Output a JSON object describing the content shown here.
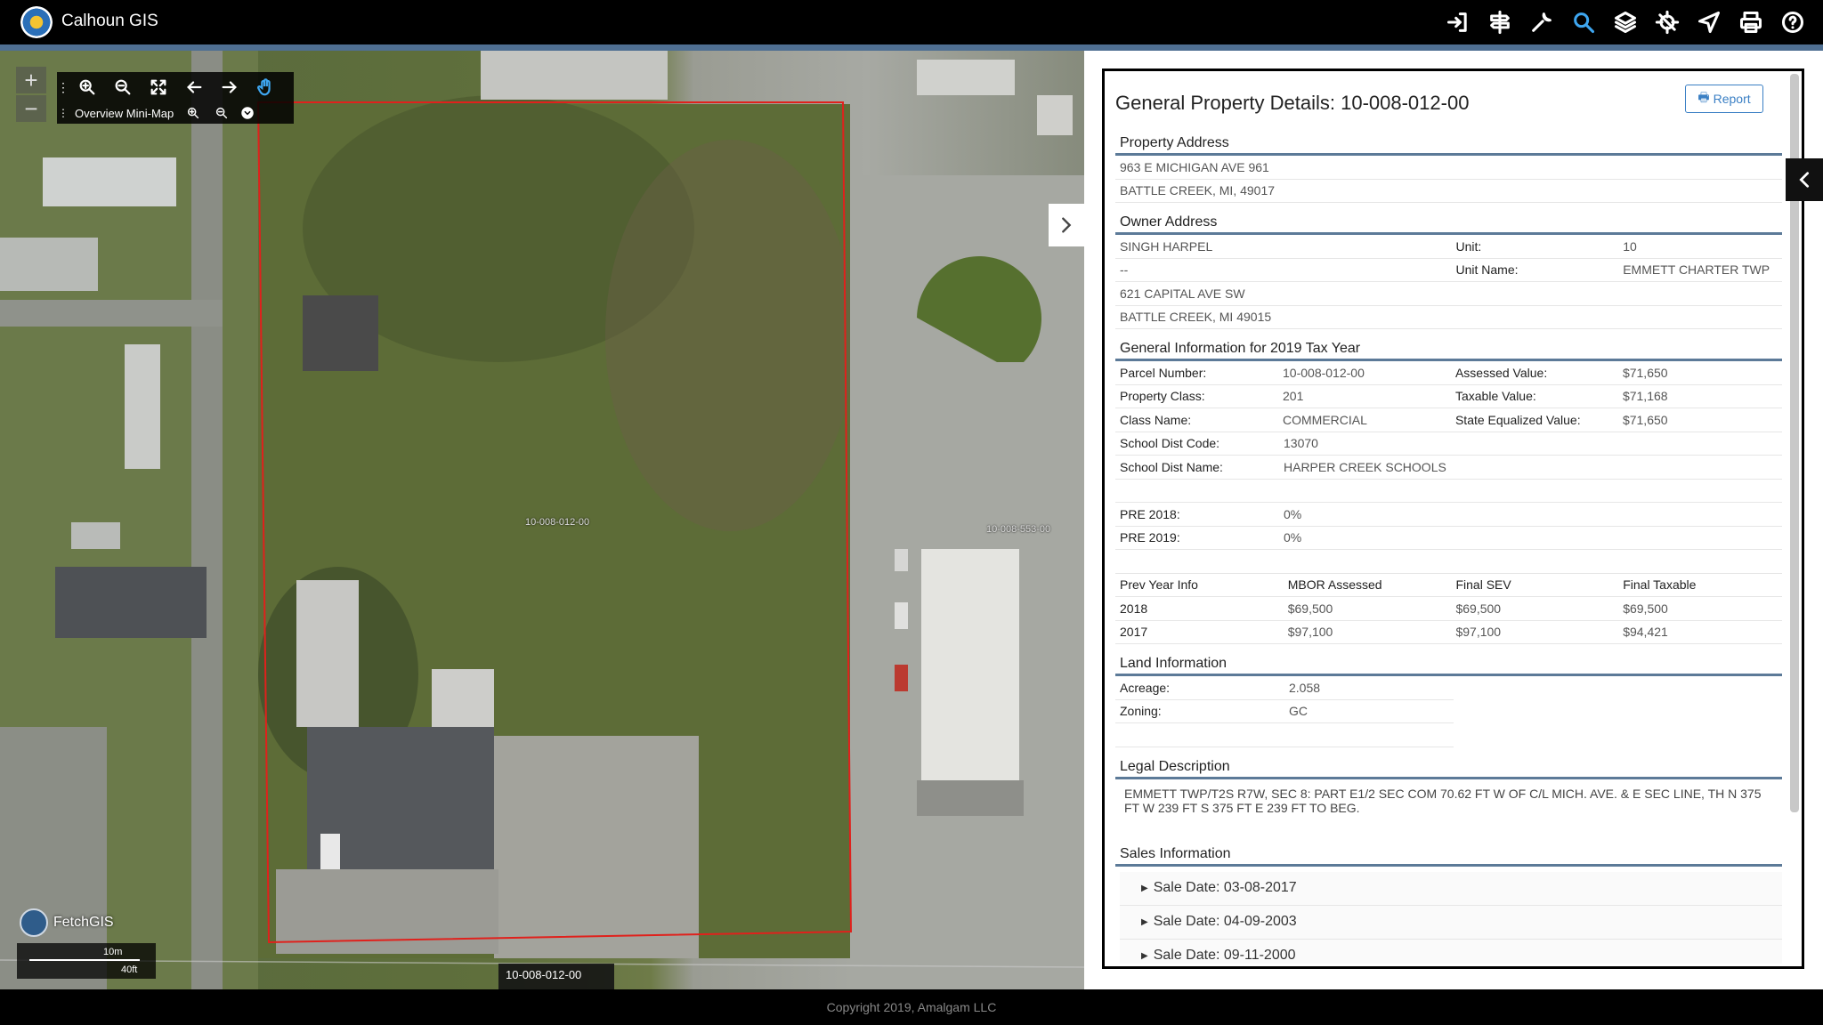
{
  "app": {
    "title": "Calhoun GIS"
  },
  "toolbar": {
    "icons": [
      "sign-in-icon",
      "signpost-icon",
      "wrench-icon",
      "search-icon",
      "layers-icon",
      "crosshair-icon",
      "paper-plane-icon",
      "print-icon",
      "help-icon"
    ],
    "active": "search-icon"
  },
  "map": {
    "minimap_label": "Overview Mini-Map",
    "parcel_label_center": "10-008-012-00",
    "parcel_label_right": "10-008-553-00",
    "tooltip_label": "10-008-012-00",
    "brand": "FetchGIS",
    "scale_metric": "10m",
    "scale_imperial": "40ft"
  },
  "panel": {
    "title": "General Property Details: 10-008-012-00",
    "report_label": "Report",
    "property_address": {
      "heading": "Property Address",
      "line1": "963 E MICHIGAN AVE 961",
      "line2": "BATTLE CREEK, MI, 49017"
    },
    "owner_address": {
      "heading": "Owner Address",
      "name": "SINGH HARPEL",
      "unit_label": "Unit:",
      "unit_value": "10",
      "line2": "--",
      "unit_name_label": "Unit Name:",
      "unit_name_value": "EMMETT CHARTER TWP",
      "line3": "621 CAPITAL AVE SW",
      "line4": "BATTLE CREEK, MI 49015"
    },
    "general_info": {
      "heading": "General Information for 2019 Tax Year",
      "rows": [
        {
          "l1": "Parcel Number:",
          "v1": "10-008-012-00",
          "l2": "Assessed Value:",
          "v2": "$71,650"
        },
        {
          "l1": "Property Class:",
          "v1": "201",
          "l2": "Taxable Value:",
          "v2": "$71,168"
        },
        {
          "l1": "Class Name:",
          "v1": "COMMERCIAL",
          "l2": "State Equalized Value:",
          "v2": "$71,650"
        },
        {
          "l1": "School Dist Code:",
          "v1": "13070",
          "l2": "",
          "v2": ""
        },
        {
          "l1": "School Dist Name:",
          "v1": "HARPER CREEK SCHOOLS",
          "l2": "",
          "v2": ""
        }
      ],
      "pre_rows": [
        {
          "label": "PRE 2018:",
          "value": "0%"
        },
        {
          "label": "PRE 2019:",
          "value": "0%"
        }
      ]
    },
    "prev_year": {
      "headers": [
        "Prev Year Info",
        "MBOR Assessed",
        "Final SEV",
        "Final Taxable"
      ],
      "rows": [
        [
          "2018",
          "$69,500",
          "$69,500",
          "$69,500"
        ],
        [
          "2017",
          "$97,100",
          "$97,100",
          "$94,421"
        ]
      ]
    },
    "land": {
      "heading": "Land Information",
      "acreage_label": "Acreage:",
      "acreage_value": "2.058",
      "zoning_label": "Zoning:",
      "zoning_value": "GC"
    },
    "legal": {
      "heading": "Legal Description",
      "text": "EMMETT TWP/T2S R7W, SEC 8: PART E1/2 SEC COM 70.62 FT W OF C/L MICH. AVE. & E SEC LINE, TH N 375 FT W 239 FT S 375 FT E 239 FT TO BEG."
    },
    "sales": {
      "heading": "Sales Information",
      "items": [
        "Sale Date: 03-08-2017",
        "Sale Date: 04-09-2003",
        "Sale Date: 09-11-2000"
      ]
    }
  },
  "footer": {
    "copyright": "Copyright 2019, Amalgam LLC"
  }
}
